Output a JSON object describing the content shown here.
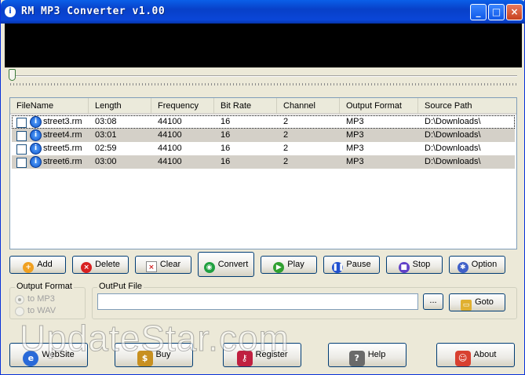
{
  "window": {
    "title": "RM MP3 Converter v1.00"
  },
  "list": {
    "columns": [
      "FileName",
      "Length",
      "Frequency",
      "Bit Rate",
      "Channel",
      "Output Format",
      "Source Path"
    ],
    "rows": [
      {
        "file": "street3.rm",
        "length": "03:08",
        "frequency": "44100",
        "bitrate": "16",
        "channel": "2",
        "format": "MP3",
        "path": "D:\\Downloads\\"
      },
      {
        "file": "street4.rm",
        "length": "03:01",
        "frequency": "44100",
        "bitrate": "16",
        "channel": "2",
        "format": "MP3",
        "path": "D:\\Downloads\\"
      },
      {
        "file": "street5.rm",
        "length": "02:59",
        "frequency": "44100",
        "bitrate": "16",
        "channel": "2",
        "format": "MP3",
        "path": "D:\\Downloads\\"
      },
      {
        "file": "street6.rm",
        "length": "03:00",
        "frequency": "44100",
        "bitrate": "16",
        "channel": "2",
        "format": "MP3",
        "path": "D:\\Downloads\\"
      }
    ]
  },
  "toolbar": {
    "add": "Add",
    "delete": "Delete",
    "clear": "Clear",
    "convert": "Convert",
    "play": "Play",
    "pause": "Pause",
    "stop": "Stop",
    "option": "Option"
  },
  "output_format": {
    "label": "Output Format",
    "mp3": "to MP3",
    "wav": "to WAV"
  },
  "output_file": {
    "label": "OutPut File",
    "value": "",
    "browse": "...",
    "goto": "Goto"
  },
  "bottom": {
    "website": "WebSite",
    "buy": "Buy",
    "register": "Register",
    "help": "Help",
    "about": "About"
  },
  "watermark": "UpdateStar.com",
  "colors": {
    "title_bar": "#0a50e0",
    "alt_row": "#d4d0c8",
    "button_border": "#003c74"
  }
}
